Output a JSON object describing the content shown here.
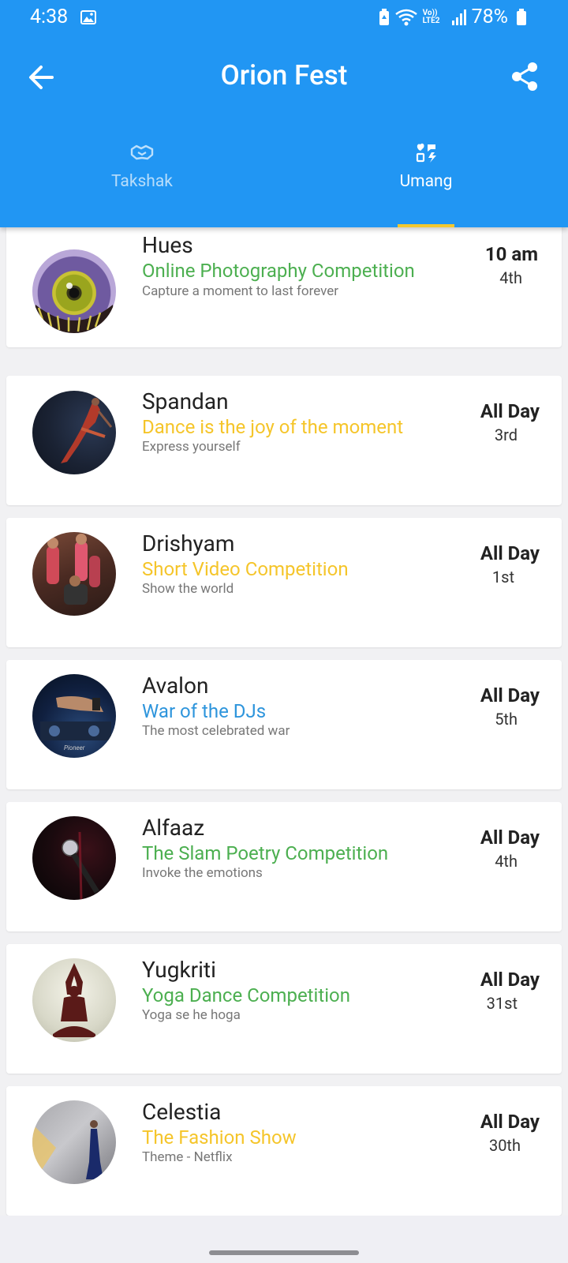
{
  "status_bar": {
    "time": "4:38",
    "battery": "78%",
    "network": "Vo)) LTE2"
  },
  "app_bar": {
    "title": "Orion Fest"
  },
  "tabs": [
    {
      "label": "Takshak",
      "icon": "handshake-icon",
      "selected": false
    },
    {
      "label": "Umang",
      "icon": "hearts-bolt-icon",
      "selected": true
    }
  ],
  "events": [
    {
      "name": "Hues",
      "subtitle": "Online Photography Competition",
      "description": "Capture a moment to last forever",
      "time": "10 am",
      "date": "4th",
      "subtitle_color": "#4caf50"
    },
    {
      "name": "Spandan",
      "subtitle": "Dance is the joy of the moment",
      "description": "Express yourself",
      "time": "All Day",
      "date": "3rd",
      "subtitle_color": "#f5c52a"
    },
    {
      "name": "Drishyam",
      "subtitle": "Short Video Competition",
      "description": "Show the world",
      "time": "All Day",
      "date": "1st",
      "subtitle_color": "#f5c52a"
    },
    {
      "name": "Avalon",
      "subtitle": "War of the DJs",
      "description": "The most celebrated war",
      "time": "All Day",
      "date": "5th",
      "subtitle_color": "#2e95dc"
    },
    {
      "name": "Alfaaz",
      "subtitle": "The Slam Poetry Competition",
      "description": "Invoke the emotions",
      "time": "All Day",
      "date": "4th",
      "subtitle_color": "#4caf50"
    },
    {
      "name": "Yugkriti",
      "subtitle": "Yoga Dance Competition",
      "description": "Yoga se he hoga",
      "time": "All Day",
      "date": "31st",
      "subtitle_color": "#4caf50"
    },
    {
      "name": "Celestia",
      "subtitle": "The Fashion Show",
      "description": "Theme - Netflix",
      "time": "All Day",
      "date": "30th",
      "subtitle_color": "#f5c52a"
    }
  ]
}
